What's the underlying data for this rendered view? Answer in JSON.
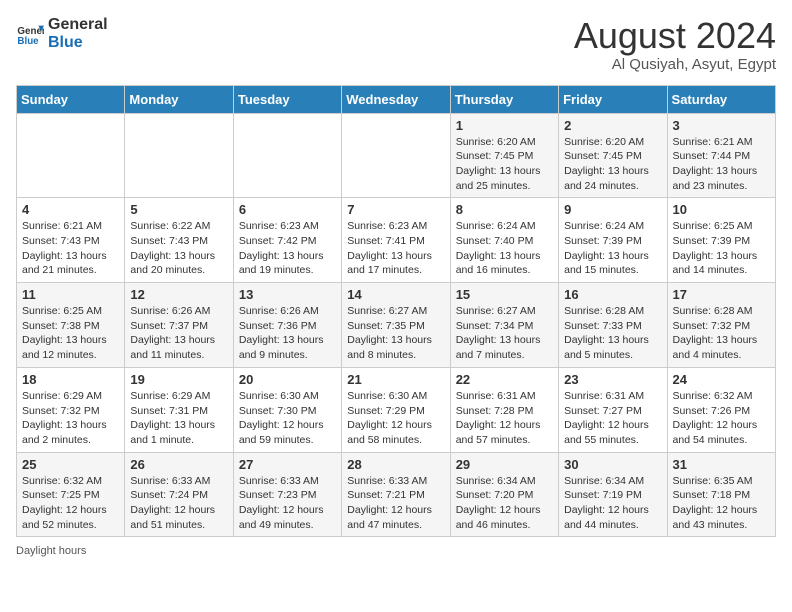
{
  "logo": {
    "line1": "General",
    "line2": "Blue"
  },
  "title": "August 2024",
  "subtitle": "Al Qusiyah, Asyut, Egypt",
  "days_of_week": [
    "Sunday",
    "Monday",
    "Tuesday",
    "Wednesday",
    "Thursday",
    "Friday",
    "Saturday"
  ],
  "weeks": [
    [
      {
        "day": "",
        "info": ""
      },
      {
        "day": "",
        "info": ""
      },
      {
        "day": "",
        "info": ""
      },
      {
        "day": "",
        "info": ""
      },
      {
        "day": "1",
        "info": "Sunrise: 6:20 AM\nSunset: 7:45 PM\nDaylight: 13 hours\nand 25 minutes."
      },
      {
        "day": "2",
        "info": "Sunrise: 6:20 AM\nSunset: 7:45 PM\nDaylight: 13 hours\nand 24 minutes."
      },
      {
        "day": "3",
        "info": "Sunrise: 6:21 AM\nSunset: 7:44 PM\nDaylight: 13 hours\nand 23 minutes."
      }
    ],
    [
      {
        "day": "4",
        "info": "Sunrise: 6:21 AM\nSunset: 7:43 PM\nDaylight: 13 hours\nand 21 minutes."
      },
      {
        "day": "5",
        "info": "Sunrise: 6:22 AM\nSunset: 7:43 PM\nDaylight: 13 hours\nand 20 minutes."
      },
      {
        "day": "6",
        "info": "Sunrise: 6:23 AM\nSunset: 7:42 PM\nDaylight: 13 hours\nand 19 minutes."
      },
      {
        "day": "7",
        "info": "Sunrise: 6:23 AM\nSunset: 7:41 PM\nDaylight: 13 hours\nand 17 minutes."
      },
      {
        "day": "8",
        "info": "Sunrise: 6:24 AM\nSunset: 7:40 PM\nDaylight: 13 hours\nand 16 minutes."
      },
      {
        "day": "9",
        "info": "Sunrise: 6:24 AM\nSunset: 7:39 PM\nDaylight: 13 hours\nand 15 minutes."
      },
      {
        "day": "10",
        "info": "Sunrise: 6:25 AM\nSunset: 7:39 PM\nDaylight: 13 hours\nand 14 minutes."
      }
    ],
    [
      {
        "day": "11",
        "info": "Sunrise: 6:25 AM\nSunset: 7:38 PM\nDaylight: 13 hours\nand 12 minutes."
      },
      {
        "day": "12",
        "info": "Sunrise: 6:26 AM\nSunset: 7:37 PM\nDaylight: 13 hours\nand 11 minutes."
      },
      {
        "day": "13",
        "info": "Sunrise: 6:26 AM\nSunset: 7:36 PM\nDaylight: 13 hours\nand 9 minutes."
      },
      {
        "day": "14",
        "info": "Sunrise: 6:27 AM\nSunset: 7:35 PM\nDaylight: 13 hours\nand 8 minutes."
      },
      {
        "day": "15",
        "info": "Sunrise: 6:27 AM\nSunset: 7:34 PM\nDaylight: 13 hours\nand 7 minutes."
      },
      {
        "day": "16",
        "info": "Sunrise: 6:28 AM\nSunset: 7:33 PM\nDaylight: 13 hours\nand 5 minutes."
      },
      {
        "day": "17",
        "info": "Sunrise: 6:28 AM\nSunset: 7:32 PM\nDaylight: 13 hours\nand 4 minutes."
      }
    ],
    [
      {
        "day": "18",
        "info": "Sunrise: 6:29 AM\nSunset: 7:32 PM\nDaylight: 13 hours\nand 2 minutes."
      },
      {
        "day": "19",
        "info": "Sunrise: 6:29 AM\nSunset: 7:31 PM\nDaylight: 13 hours\nand 1 minute."
      },
      {
        "day": "20",
        "info": "Sunrise: 6:30 AM\nSunset: 7:30 PM\nDaylight: 12 hours\nand 59 minutes."
      },
      {
        "day": "21",
        "info": "Sunrise: 6:30 AM\nSunset: 7:29 PM\nDaylight: 12 hours\nand 58 minutes."
      },
      {
        "day": "22",
        "info": "Sunrise: 6:31 AM\nSunset: 7:28 PM\nDaylight: 12 hours\nand 57 minutes."
      },
      {
        "day": "23",
        "info": "Sunrise: 6:31 AM\nSunset: 7:27 PM\nDaylight: 12 hours\nand 55 minutes."
      },
      {
        "day": "24",
        "info": "Sunrise: 6:32 AM\nSunset: 7:26 PM\nDaylight: 12 hours\nand 54 minutes."
      }
    ],
    [
      {
        "day": "25",
        "info": "Sunrise: 6:32 AM\nSunset: 7:25 PM\nDaylight: 12 hours\nand 52 minutes."
      },
      {
        "day": "26",
        "info": "Sunrise: 6:33 AM\nSunset: 7:24 PM\nDaylight: 12 hours\nand 51 minutes."
      },
      {
        "day": "27",
        "info": "Sunrise: 6:33 AM\nSunset: 7:23 PM\nDaylight: 12 hours\nand 49 minutes."
      },
      {
        "day": "28",
        "info": "Sunrise: 6:33 AM\nSunset: 7:21 PM\nDaylight: 12 hours\nand 47 minutes."
      },
      {
        "day": "29",
        "info": "Sunrise: 6:34 AM\nSunset: 7:20 PM\nDaylight: 12 hours\nand 46 minutes."
      },
      {
        "day": "30",
        "info": "Sunrise: 6:34 AM\nSunset: 7:19 PM\nDaylight: 12 hours\nand 44 minutes."
      },
      {
        "day": "31",
        "info": "Sunrise: 6:35 AM\nSunset: 7:18 PM\nDaylight: 12 hours\nand 43 minutes."
      }
    ]
  ],
  "footer": "Daylight hours"
}
